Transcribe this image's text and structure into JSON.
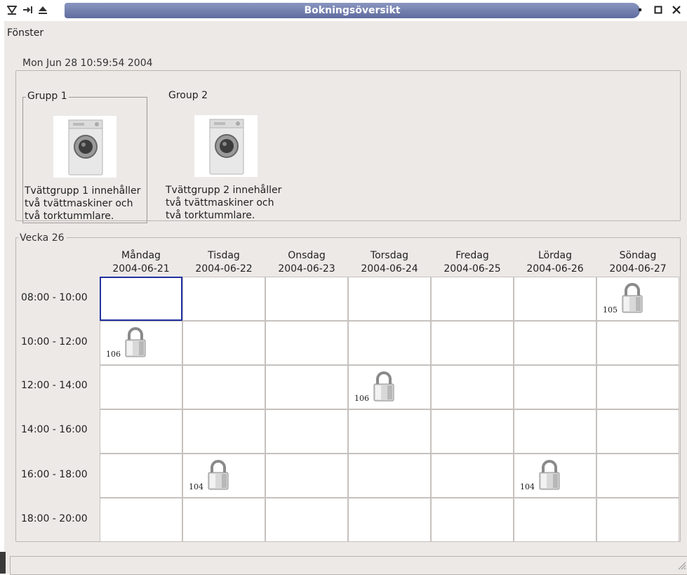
{
  "window": {
    "title": "Bokningsöversikt"
  },
  "menu": {
    "items": [
      "Fönster"
    ]
  },
  "timestamp": "Mon Jun 28 10:59:54 2004",
  "groups": [
    {
      "label": "Grupp 1",
      "desc": [
        "Tvättgrupp 1 innehåller",
        "två tvättmaskiner och",
        "två torktummlare."
      ],
      "selected": true,
      "icon": "washing-machine-icon"
    },
    {
      "label": "Group 2",
      "desc": [
        "Tvättgrupp 2 innehåller",
        "två tvättmaskiner och",
        "två torktummlare."
      ],
      "selected": false,
      "icon": "washing-machine-icon"
    }
  ],
  "week": {
    "label": "Vecka 26",
    "days": [
      {
        "name": "Måndag",
        "date": "2004-06-21"
      },
      {
        "name": "Tisdag",
        "date": "2004-06-22"
      },
      {
        "name": "Onsdag",
        "date": "2004-06-23"
      },
      {
        "name": "Torsdag",
        "date": "2004-06-24"
      },
      {
        "name": "Fredag",
        "date": "2004-06-25"
      },
      {
        "name": "Lördag",
        "date": "2004-06-26"
      },
      {
        "name": "Söndag",
        "date": "2004-06-27"
      }
    ],
    "slots": [
      "08:00 - 10:00",
      "10:00 - 12:00",
      "12:00 - 14:00",
      "14:00 - 16:00",
      "16:00 - 18:00",
      "18:00 - 20:00"
    ],
    "selected_cell": {
      "slot": 0,
      "day": 0
    },
    "bookings": [
      {
        "slot": 0,
        "day": 6,
        "room": "105",
        "icon": "padlock-icon"
      },
      {
        "slot": 1,
        "day": 0,
        "room": "106",
        "icon": "padlock-icon"
      },
      {
        "slot": 2,
        "day": 3,
        "room": "106",
        "icon": "padlock-icon"
      },
      {
        "slot": 4,
        "day": 1,
        "room": "104",
        "icon": "padlock-icon"
      },
      {
        "slot": 4,
        "day": 5,
        "room": "104",
        "icon": "padlock-icon"
      }
    ]
  }
}
